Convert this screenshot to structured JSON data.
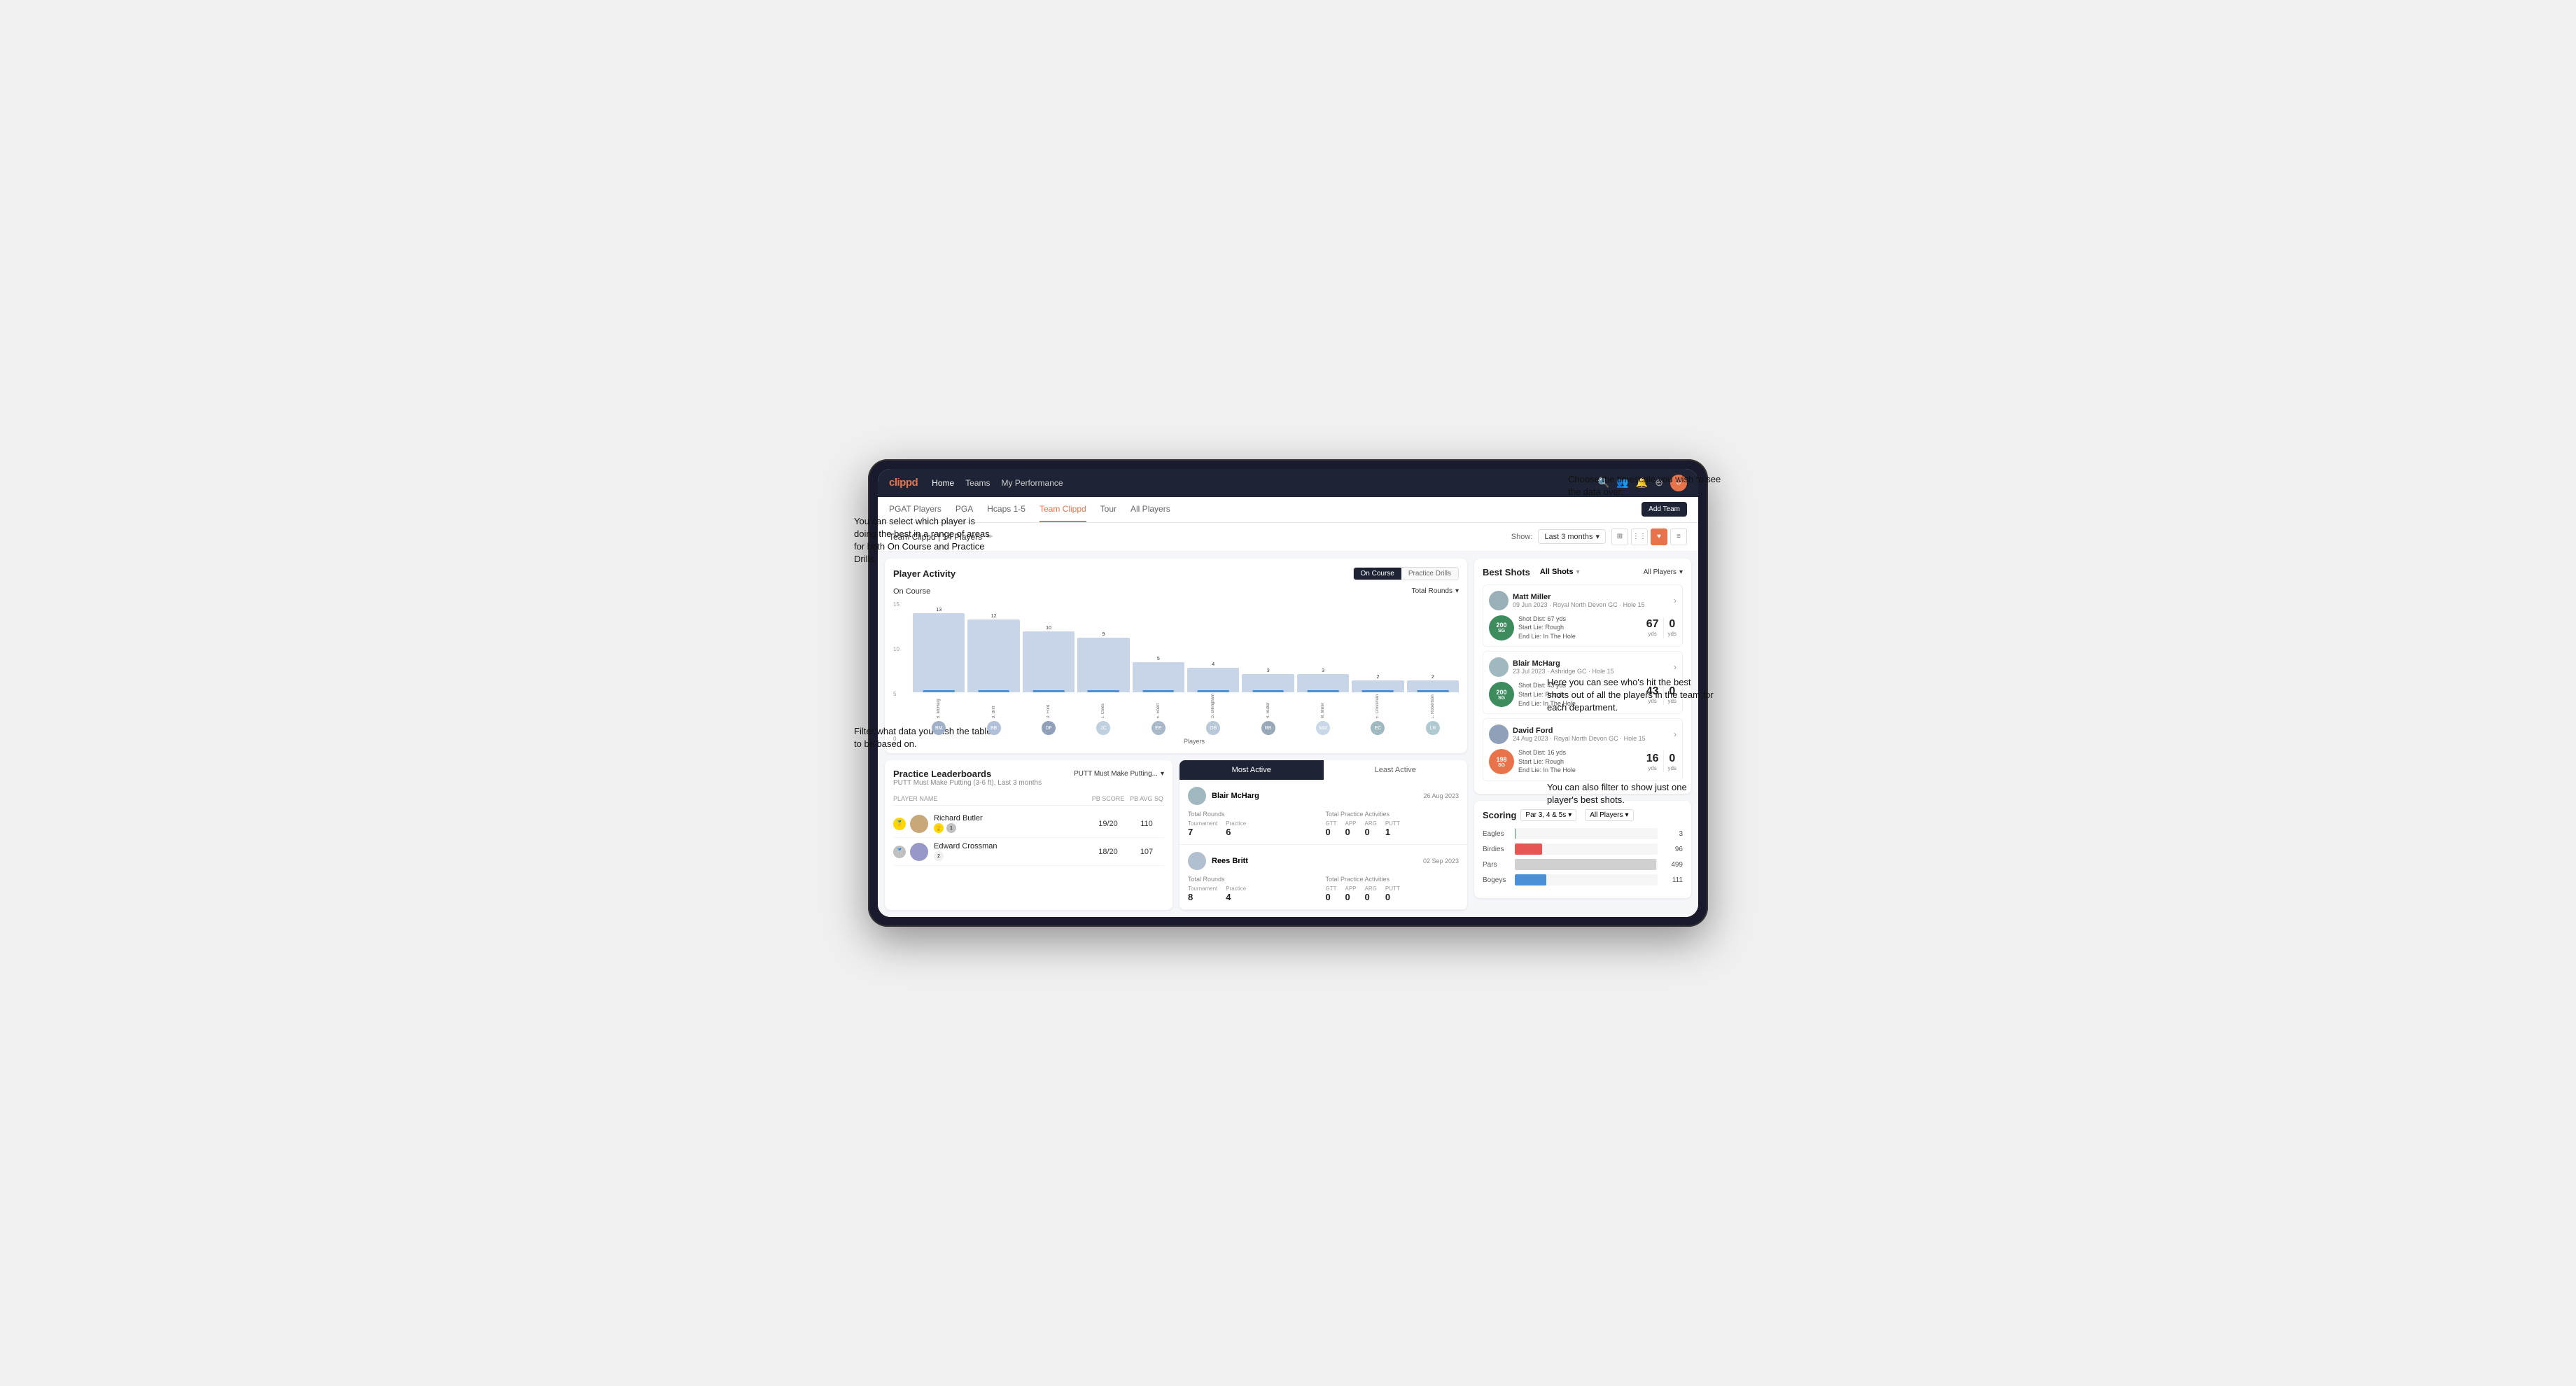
{
  "annotations": {
    "top_right": "Choose the timescale you wish to see the data over.",
    "left_top": "You can select which player is doing the best in a range of areas for both On Course and Practice Drills.",
    "left_bottom": "Filter what data you wish the table to be based on.",
    "right_mid": "Here you can see who's hit the best shots out of all the players in the team for each department.",
    "right_bottom": "You can also filter to show just one player's best shots."
  },
  "nav": {
    "logo": "clippd",
    "links": [
      "Home",
      "Teams",
      "My Performance"
    ],
    "icons": [
      "search",
      "users",
      "bell",
      "plus-circle",
      "user"
    ]
  },
  "sub_nav": {
    "links": [
      "PGAT Players",
      "PGA",
      "Hcaps 1-5",
      "Team Clippd",
      "Tour",
      "All Players"
    ],
    "active": "Team Clippd",
    "add_team_btn": "Add Team"
  },
  "team_header": {
    "name": "Team Clippd | 14 Players",
    "show_label": "Show:",
    "timeframe": "Last 3 months",
    "views": [
      "grid-lg",
      "grid-sm",
      "heart",
      "list"
    ]
  },
  "player_activity": {
    "title": "Player Activity",
    "tabs": [
      "On Course",
      "Practice Drills"
    ],
    "active_tab": "On Course",
    "section_label": "On Course",
    "metric": "Total Rounds",
    "x_axis_label": "Players",
    "bars": [
      {
        "name": "B. McHarg",
        "value": 13
      },
      {
        "name": "B. Britt",
        "value": 12
      },
      {
        "name": "D. Ford",
        "value": 10
      },
      {
        "name": "J. Coles",
        "value": 9
      },
      {
        "name": "E. Ebert",
        "value": 5
      },
      {
        "name": "O. Billingham",
        "value": 4
      },
      {
        "name": "R. Butler",
        "value": 3
      },
      {
        "name": "M. Miller",
        "value": 3
      },
      {
        "name": "E. Crossman",
        "value": 2
      },
      {
        "name": "L. Robertson",
        "value": 2
      }
    ],
    "y_axis": [
      "15",
      "10",
      "5",
      "0"
    ]
  },
  "best_shots": {
    "title": "Best Shots",
    "filters": [
      "All Shots",
      "All Players"
    ],
    "active_filter": "All Shots",
    "players_label": "All Players",
    "shots": [
      {
        "player": "Matt Miller",
        "date": "09 Jun 2023",
        "course": "Royal North Devon GC",
        "hole": "Hole 15",
        "badge_text": "200",
        "badge_sub": "SG",
        "badge_color": "green",
        "dist": "Shot Dist: 67 yds\nStart Lie: Rough\nEnd Lie: In The Hole",
        "yds": 67,
        "yds2": 0
      },
      {
        "player": "Blair McHarg",
        "date": "23 Jul 2023",
        "course": "Ashridge GC",
        "hole": "Hole 15",
        "badge_text": "200",
        "badge_sub": "SG",
        "badge_color": "green",
        "dist": "Shot Dist: 43 yds\nStart Lie: Rough\nEnd Lie: In The Hole",
        "yds": 43,
        "yds2": 0
      },
      {
        "player": "David Ford",
        "date": "24 Aug 2023",
        "course": "Royal North Devon GC",
        "hole": "Hole 15",
        "badge_text": "198",
        "badge_sub": "SG",
        "badge_color": "pink",
        "dist": "Shot Dist: 16 yds\nStart Lie: Rough\nEnd Lie: In The Hole",
        "yds": 16,
        "yds2": 0
      }
    ]
  },
  "practice_leaderboard": {
    "title": "Practice Leaderboards",
    "practice_label": "PUTT Must Make Putting...",
    "subtitle": "PUTT Must Make Putting (3-6 ft), Last 3 months",
    "cols": [
      "PLAYER NAME",
      "PB SCORE",
      "PB AVG SQ"
    ],
    "rows": [
      {
        "rank": 1,
        "name": "Richard Butler",
        "score": "19/20",
        "avg": "110"
      },
      {
        "rank": 2,
        "name": "Edward Crossman",
        "score": "18/20",
        "avg": "107"
      }
    ]
  },
  "most_active": {
    "tabs": [
      "Most Active",
      "Least Active"
    ],
    "active_tab": "Most Active",
    "players": [
      {
        "name": "Blair McHarg",
        "date": "26 Aug 2023",
        "total_rounds_label": "Total Rounds",
        "tournament": 7,
        "practice": 6,
        "total_practice_label": "Total Practice Activities",
        "gtt": 0,
        "app": 0,
        "arg": 0,
        "putt": 1
      },
      {
        "name": "Rees Britt",
        "date": "02 Sep 2023",
        "total_rounds_label": "Total Rounds",
        "tournament": 8,
        "practice": 4,
        "total_practice_label": "Total Practice Activities",
        "gtt": 0,
        "app": 0,
        "arg": 0,
        "putt": 0
      }
    ]
  },
  "scoring": {
    "title": "Scoring",
    "filter1": "Par 3, 4 & 5s",
    "filter2": "All Players",
    "bars": [
      {
        "label": "Eagles",
        "value": 3,
        "max": 500,
        "color": "green"
      },
      {
        "label": "Birdies",
        "value": 96,
        "max": 500,
        "color": "red"
      },
      {
        "label": "Pars",
        "value": 499,
        "max": 500,
        "color": "gray"
      },
      {
        "label": "Bogeys",
        "value": 111,
        "max": 500,
        "color": "blue"
      }
    ]
  }
}
